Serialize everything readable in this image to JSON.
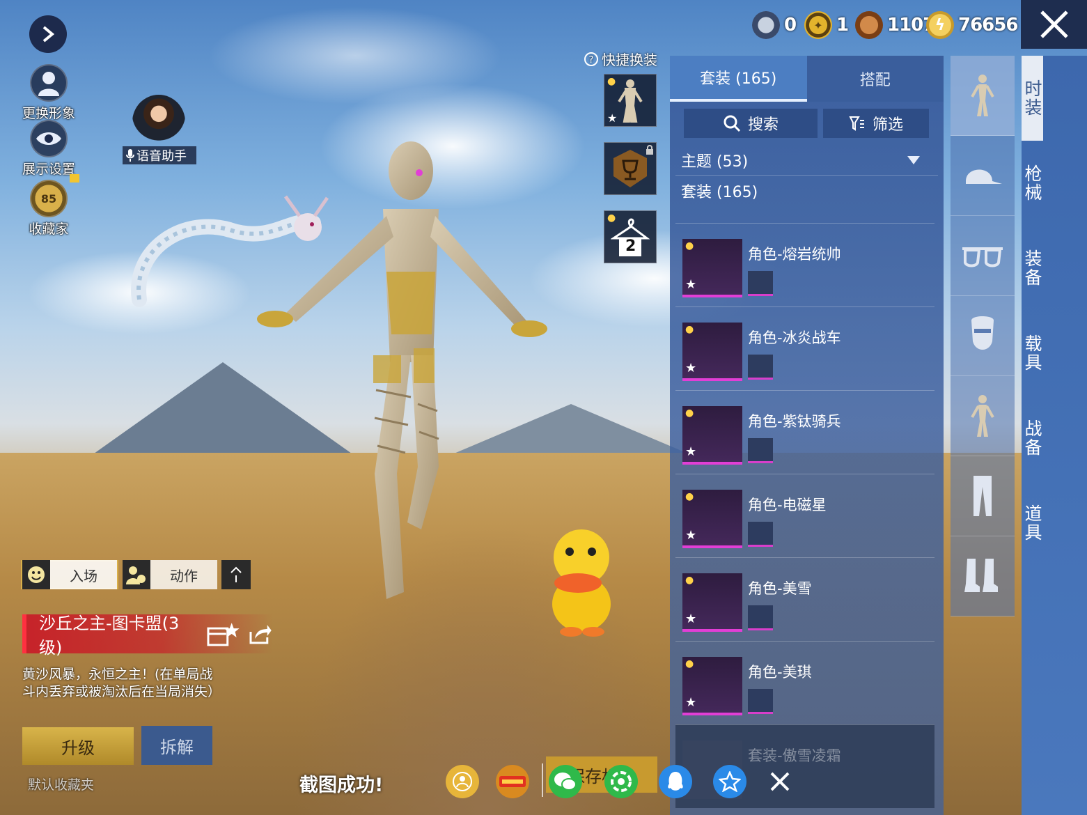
{
  "currencies": [
    {
      "icon": "rank-coin-icon",
      "value": "0"
    },
    {
      "icon": "gold-token-icon",
      "value": "1"
    },
    {
      "icon": "bronze-coin-icon",
      "value": "1107"
    },
    {
      "icon": "lightning-coin-icon",
      "value": "76656"
    }
  ],
  "left_tools": {
    "change_avatar": "更换形象",
    "display_settings": "展示设置",
    "collector": "收藏家",
    "collector_level": "85",
    "voice_assistant": "语音助手"
  },
  "quick_change": {
    "label": "快捷换装",
    "slot3_number": "2"
  },
  "panel": {
    "tabs": [
      {
        "label": "套装 (165)",
        "active": true
      },
      {
        "label": "搭配",
        "active": false
      }
    ],
    "search_label": "搜索",
    "filter_label": "筛选",
    "theme_section": "主题 (53)",
    "suit_section": "套装 (165)",
    "items": [
      {
        "name": "角色-熔岩统帅"
      },
      {
        "name": "角色-冰炎战车"
      },
      {
        "name": "角色-紫钛骑兵"
      },
      {
        "name": "角色-电磁星"
      },
      {
        "name": "角色-美雪"
      },
      {
        "name": "角色-美琪"
      },
      {
        "name": "套装-傲雪凌霜"
      }
    ]
  },
  "right_nav": [
    {
      "label": "时装",
      "active": true
    },
    {
      "label": "枪械",
      "active": false
    },
    {
      "label": "装备",
      "active": false
    },
    {
      "label": "载具",
      "active": false
    },
    {
      "label": "战备",
      "active": false
    },
    {
      "label": "道具",
      "active": false
    }
  ],
  "bottom_left": {
    "entrance": "入场",
    "action": "动作",
    "item_title": "沙丘之主-图卡盟(3级)",
    "description": "黄沙风暴，永恒之主！(在单局战斗内丢弃或被淘汰后在当局消失）",
    "upgrade": "升级",
    "dismantle": "拆解",
    "default_folder": "默认收藏夹"
  },
  "share_bar": {
    "toast": "截图成功!",
    "save_label": "保存相册"
  },
  "colors": {
    "panel_blue": "#3d68ad",
    "highlight_pink": "#e23ed6",
    "upgrade_gold": "#d8b44a",
    "title_red": "#c81e28"
  }
}
